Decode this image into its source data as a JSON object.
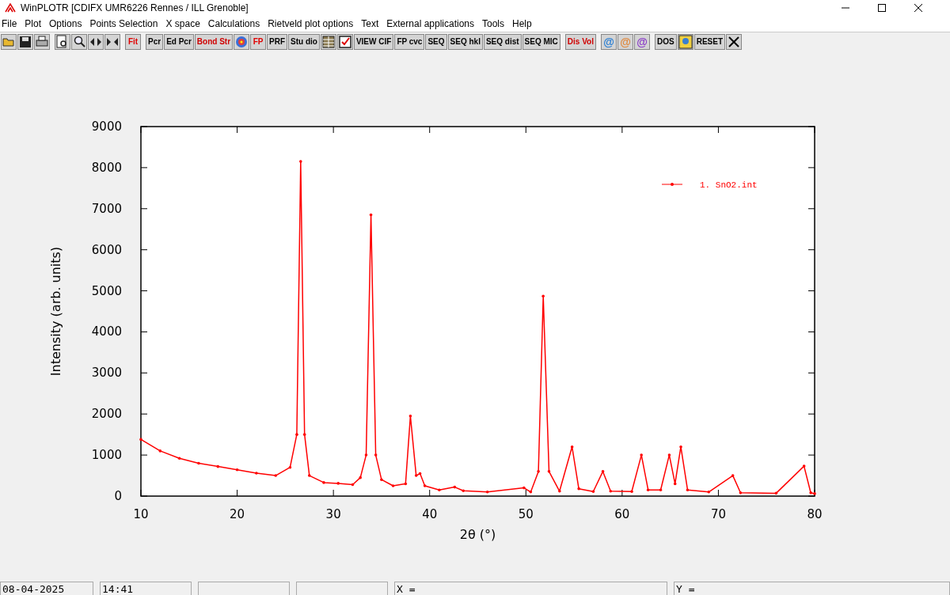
{
  "window": {
    "title": "WinPLOTR [CDIFX UMR6226 Rennes / ILL Grenoble]"
  },
  "menu": [
    "File",
    "Plot",
    "Options",
    "Points Selection",
    "X space",
    "Calculations",
    "Rietveld plot options",
    "Text",
    "External applications",
    "Tools",
    "Help"
  ],
  "toolbar": [
    [
      {
        "kind": "icon"
      },
      {
        "kind": "icon"
      },
      {
        "kind": "icon"
      }
    ],
    [
      {
        "kind": "icon"
      },
      {
        "kind": "icon"
      },
      {
        "kind": "icon"
      },
      {
        "kind": "icon"
      }
    ],
    [
      {
        "kind": "label",
        "label": "Fit",
        "color": "#e00000"
      }
    ],
    [
      {
        "kind": "label",
        "label": "Pcr",
        "color": "#000000"
      },
      {
        "kind": "label",
        "label": "Ed Pcr",
        "color": "#000000"
      },
      {
        "kind": "label",
        "label": "Bond Str",
        "color": "#d00000"
      },
      {
        "kind": "icon"
      },
      {
        "kind": "label",
        "label": "FP",
        "color": "#e00000"
      },
      {
        "kind": "label",
        "label": "PRF",
        "color": "#000000"
      },
      {
        "kind": "label",
        "label": "Stu dio",
        "color": "#000000"
      },
      {
        "kind": "icon"
      },
      {
        "kind": "icon"
      },
      {
        "kind": "label",
        "label": "VIEW CIF",
        "color": "#000000"
      },
      {
        "kind": "label",
        "label": "FP cvc",
        "color": "#000000"
      },
      {
        "kind": "label",
        "label": "SEQ",
        "color": "#000000"
      },
      {
        "kind": "label",
        "label": "SEQ hkl",
        "color": "#000000"
      },
      {
        "kind": "label",
        "label": "SEQ dist",
        "color": "#000000"
      },
      {
        "kind": "label",
        "label": "SEQ MIC",
        "color": "#000000"
      }
    ],
    [
      {
        "kind": "label",
        "label": "Dis Vol",
        "color": "#d00000"
      }
    ],
    [
      {
        "kind": "label",
        "label": "@",
        "color": "#2a7fd4"
      },
      {
        "kind": "label",
        "label": "@",
        "color": "#e08a40"
      },
      {
        "kind": "label",
        "label": "@",
        "color": "#8a3cc8"
      }
    ],
    [
      {
        "kind": "label",
        "label": "DOS",
        "color": "#000000"
      },
      {
        "kind": "icon"
      },
      {
        "kind": "label",
        "label": "RESET",
        "color": "#000000"
      },
      {
        "kind": "icon"
      }
    ]
  ],
  "chart_data": {
    "type": "line",
    "xlabel": "2θ (°)",
    "ylabel": "Intensity (arb. units)",
    "xlim": [
      10,
      80
    ],
    "ylim": [
      0,
      9000
    ],
    "xticks": [
      10,
      20,
      30,
      40,
      50,
      60,
      70,
      80
    ],
    "yticks": [
      0,
      1000,
      2000,
      3000,
      4000,
      5000,
      6000,
      7000,
      8000,
      9000
    ],
    "x": [
      10,
      12,
      14,
      16,
      18,
      20,
      22,
      24,
      25.5,
      26.2,
      26.6,
      27,
      27.5,
      29,
      30.5,
      32,
      32.8,
      33.4,
      33.9,
      34.4,
      35,
      36.2,
      37.5,
      38,
      38.6,
      39,
      39.5,
      41,
      42.6,
      43.5,
      46,
      49.8,
      50.5,
      51.3,
      51.8,
      52.4,
      53.5,
      54.8,
      55.5,
      57,
      58,
      58.8,
      61,
      62,
      62.7,
      64,
      64.9,
      65.5,
      66.1,
      66.8,
      69,
      71.5,
      72.3,
      76,
      78.9,
      79.6,
      80
    ],
    "series": [
      {
        "name": "1. SnO2.int",
        "color": "#ff0000",
        "values": [
          1380,
          1100,
          920,
          800,
          720,
          640,
          560,
          500,
          700,
          1500,
          8150,
          1500,
          500,
          330,
          310,
          280,
          450,
          1000,
          6850,
          1000,
          400,
          250,
          300,
          1950,
          500,
          550,
          250,
          150,
          220,
          130,
          100,
          200,
          100,
          600,
          4870,
          600,
          120,
          1200,
          180,
          110,
          600,
          120,
          110,
          1000,
          150,
          150,
          1000,
          300,
          1200,
          150,
          100,
          500,
          80,
          70,
          730,
          80,
          60
        ]
      }
    ]
  },
  "status_bar": {
    "date": "08-04-2025",
    "time": "14:41",
    "x_readout": "X =",
    "y_readout": "Y ="
  }
}
